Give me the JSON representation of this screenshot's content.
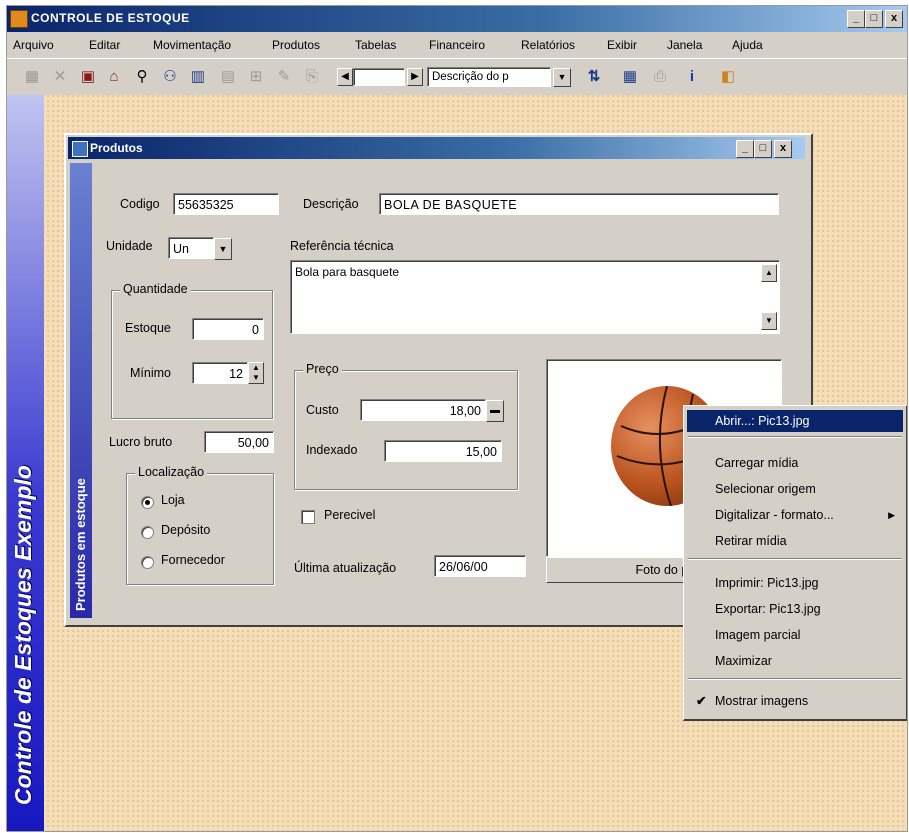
{
  "window": {
    "title": "CONTROLE DE ESTOQUE",
    "min_glyph": "_",
    "max_glyph": "□",
    "close_glyph": "x"
  },
  "menubar": {
    "items": [
      "Arquivo",
      "Editar",
      "Movimentação",
      "Produtos",
      "Tabelas",
      "Financeiro",
      "Relatórios",
      "Exibir",
      "Janela",
      "Ajuda"
    ]
  },
  "toolbar": {
    "nav_field_value": "",
    "search_field_select": "Descrição do p",
    "icons": [
      "delete-icon",
      "cut-icon",
      "paste-icon",
      "copy-icon",
      "binoculars-icon",
      "users-icon",
      "calendar-icon",
      "grid-icon",
      "print-preview-icon",
      "tool-icon",
      "export-icon",
      "nav-prev-icon",
      "nav-next-icon",
      "sort-icon",
      "calendar-print-icon",
      "printer-icon",
      "info-icon",
      "exit-icon"
    ]
  },
  "sidebar": {
    "text": "Controle de Estoques Exemplo"
  },
  "child": {
    "title": "Produtos",
    "vertical_tab": "Produtos em estoque",
    "codigo_label": "Codigo",
    "codigo_value": "55635325",
    "descricao_label": "Descrição",
    "descricao_value": "BOLA DE BASQUETE",
    "unidade_label": "Unidade",
    "unidade_value": "Un",
    "ref_label": "Referência técnica",
    "ref_value": "Bola para basquete",
    "quantidade_label": "Quantidade",
    "estoque_label": "Estoque",
    "estoque_value": "0",
    "minimo_label": "Mínimo",
    "minimo_value": "12",
    "lucro_label": "Lucro bruto",
    "lucro_value": "50,00",
    "localizacao_label": "Localização",
    "loc_options": [
      "Loja",
      "Depósito",
      "Fornecedor"
    ],
    "loc_selected": "Loja",
    "preco_label": "Preço",
    "custo_label": "Custo",
    "custo_value": "18,00",
    "indexado_label": "Indexado",
    "indexado_value": "15,00",
    "perecivel_label": "Perecivel",
    "perecivel_checked": false,
    "ultima_label": "Última atualização",
    "ultima_value": "26/06/00",
    "foto_label": "Foto do pr"
  },
  "context_menu": {
    "items": [
      {
        "label": "Abrir...: Pic13.jpg",
        "selected": true
      },
      {
        "label": "Carregar mídia"
      },
      {
        "label": "Selecionar origem"
      },
      {
        "label": "Digitalizar - formato...",
        "submenu": true
      },
      {
        "label": "Retirar mídia"
      },
      {
        "label": "Imprimir: Pic13.jpg"
      },
      {
        "label": "Exportar: Pic13.jpg"
      },
      {
        "label": "Imagem parcial"
      },
      {
        "label": "Maximizar"
      },
      {
        "label": "Mostrar imagens",
        "checked": true
      }
    ]
  }
}
